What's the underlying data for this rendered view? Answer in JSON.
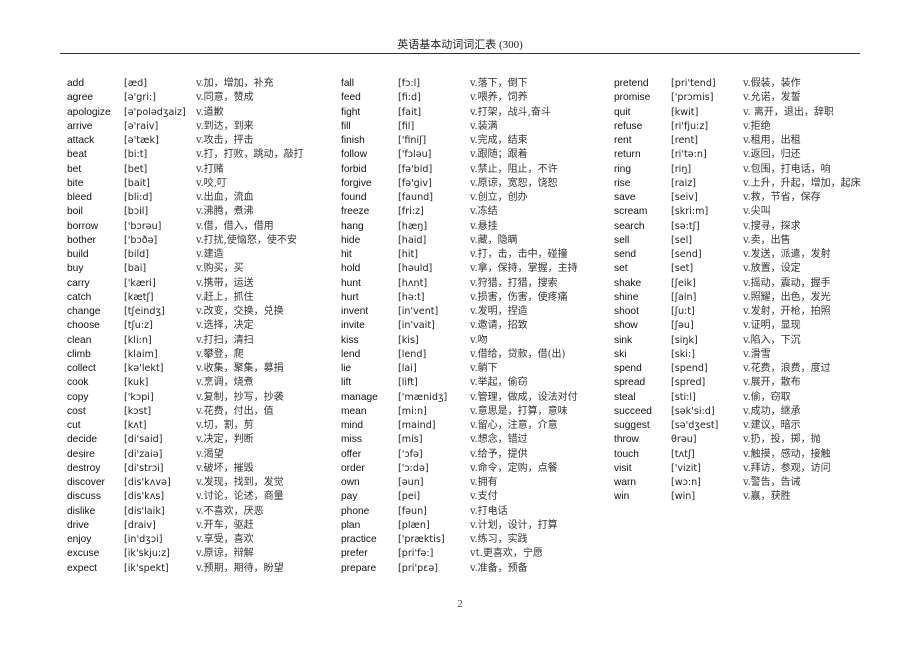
{
  "header": {
    "title": "英语基本动词词汇表 (300)"
  },
  "page_number": "2",
  "columns": [
    [
      {
        "word": "add",
        "ipa": "[æd]",
        "meaning": "v.加，增加，补充"
      },
      {
        "word": "agree",
        "ipa": "[ə'gri:]",
        "meaning": "v.同意，赞成"
      },
      {
        "word": "apologize",
        "ipa": "[ə'polədʒaiz]",
        "meaning": "v.道歉"
      },
      {
        "word": "arrive",
        "ipa": "[ə'raiv]",
        "meaning": "v.到达，到来"
      },
      {
        "word": "attack",
        "ipa": "[ə'tæk]",
        "meaning": "v.攻击，抨击"
      },
      {
        "word": "beat",
        "ipa": "[bi:t]",
        "meaning": "v.打，打败，跳动，敲打"
      },
      {
        "word": "bet",
        "ipa": "[bet]",
        "meaning": "v.打赌"
      },
      {
        "word": "bite",
        "ipa": "[bait]",
        "meaning": "v.咬,叮"
      },
      {
        "word": "bleed",
        "ipa": "[bli:d]",
        "meaning": "v.出血，流血"
      },
      {
        "word": "boil",
        "ipa": "[bɔil]",
        "meaning": "v.沸腾，煮沸"
      },
      {
        "word": "borrow",
        "ipa": "['bɔrəu]",
        "meaning": "v.借，借入，借用"
      },
      {
        "word": "bother",
        "ipa": "['bɔðə]",
        "meaning": "v.打扰,使恼怒，使不安"
      },
      {
        "word": "build",
        "ipa": "[bild]",
        "meaning": "v.建造"
      },
      {
        "word": "buy",
        "ipa": "[bai]",
        "meaning": "v.购买，买"
      },
      {
        "word": "carry",
        "ipa": "['kæri]",
        "meaning": "v.携带，运送"
      },
      {
        "word": "catch",
        "ipa": "[kætʃ]",
        "meaning": "v.赶上，抓住"
      },
      {
        "word": "change",
        "ipa": "[tʃeindʒ]",
        "meaning": "v.改变，交换，兑换"
      },
      {
        "word": "choose",
        "ipa": "[tʃu:z]",
        "meaning": "v.选择，决定"
      },
      {
        "word": "clean",
        "ipa": "[kli:n]",
        "meaning": "v.打扫，清扫"
      },
      {
        "word": "climb",
        "ipa": "[klaim]",
        "meaning": "v.攀登，爬"
      },
      {
        "word": "collect",
        "ipa": "[kə'lekt]",
        "meaning": "v.收集，聚集，募捐"
      },
      {
        "word": "cook",
        "ipa": "[kuk]",
        "meaning": "v.烹调，烧煮"
      },
      {
        "word": "copy",
        "ipa": "['kɔpi]",
        "meaning": "v.复制，抄写，抄袭"
      },
      {
        "word": "cost",
        "ipa": "[kɔst]",
        "meaning": "v.花费，付出，值"
      },
      {
        "word": "cut",
        "ipa": "[kʌt]",
        "meaning": "v.切，割，剪"
      },
      {
        "word": "decide",
        "ipa": "[di'said]",
        "meaning": "v.决定，判断"
      },
      {
        "word": "desire",
        "ipa": "[di'zaiə]",
        "meaning": "v.渴望"
      },
      {
        "word": "destroy",
        "ipa": "[di'strɔi]",
        "meaning": "v.破坏，摧毁"
      },
      {
        "word": "discover",
        "ipa": "[dis'kʌvə]",
        "meaning": "v.发现，找到，发觉"
      },
      {
        "word": "discuss",
        "ipa": "[dis'kʌs]",
        "meaning": "v.讨论，论述，商量"
      },
      {
        "word": "dislike",
        "ipa": "[dis'laik]",
        "meaning": "v.不喜欢，厌恶"
      },
      {
        "word": "drive",
        "ipa": "[draiv]",
        "meaning": "v.开车，驱赶"
      },
      {
        "word": "enjoy",
        "ipa": "[in'dʒɔi]",
        "meaning": "v.享受，喜欢"
      },
      {
        "word": "excuse",
        "ipa": "[ik'skju:z]",
        "meaning": "v.原谅，辩解"
      },
      {
        "word": "expect",
        "ipa": "[ik'spekt]",
        "meaning": "v.预期，期待，盼望"
      }
    ],
    [
      {
        "word": "fall",
        "ipa": "[fɔ:l]",
        "meaning": "v.落下，倒下"
      },
      {
        "word": "feed",
        "ipa": "[fi:d]",
        "meaning": "v.喂养，饲养"
      },
      {
        "word": "fight",
        "ipa": "[fait]",
        "meaning": "v.打架，战斗,奋斗"
      },
      {
        "word": "fill",
        "ipa": "[fil]",
        "meaning": "v.装满"
      },
      {
        "word": "finish",
        "ipa": "['finiʃ]",
        "meaning": "v.完成，结束"
      },
      {
        "word": "follow",
        "ipa": "['fɔləu]",
        "meaning": "v.跟随；跟着"
      },
      {
        "word": "forbid",
        "ipa": "[fə'bid]",
        "meaning": "v.禁止，阻止，不许"
      },
      {
        "word": "forgive",
        "ipa": "[fə'giv]",
        "meaning": "v.原谅，宽恕，饶恕"
      },
      {
        "word": "found",
        "ipa": "[faund]",
        "meaning": "v.创立，创办"
      },
      {
        "word": "freeze",
        "ipa": "[fri:z]",
        "meaning": "v.冻结"
      },
      {
        "word": "hang",
        "ipa": "[hæŋ]",
        "meaning": "v.悬挂"
      },
      {
        "word": "hide",
        "ipa": "[haid]",
        "meaning": "v.藏，隐瞒"
      },
      {
        "word": "hit",
        "ipa": "[hit]",
        "meaning": "v.打，击，击中，碰撞"
      },
      {
        "word": "hold",
        "ipa": "[həuld]",
        "meaning": "v.拿，保持，掌握，主持"
      },
      {
        "word": "hunt",
        "ipa": "[hʌnt]",
        "meaning": "v.狩猎，打猎，搜索"
      },
      {
        "word": "hurt",
        "ipa": "[hə:t]",
        "meaning": "v.损害，伤害，使疼痛"
      },
      {
        "word": "invent",
        "ipa": "[in'vent]",
        "meaning": "v.发明，捏造"
      },
      {
        "word": "invite",
        "ipa": "[in'vait]",
        "meaning": "v.邀请，招致"
      },
      {
        "word": "kiss",
        "ipa": "[kis]",
        "meaning": "v.吻"
      },
      {
        "word": "lend",
        "ipa": "[lend]",
        "meaning": "v.借给，贷款，借(出)"
      },
      {
        "word": "lie",
        "ipa": "[lai]",
        "meaning": "v.躺下"
      },
      {
        "word": "lift",
        "ipa": "[lift]",
        "meaning": "v.举起，偷窃"
      },
      {
        "word": "manage",
        "ipa": "['mænidʒ]",
        "meaning": "v.管理，做成，设法对付"
      },
      {
        "word": "mean",
        "ipa": "[mi:n]",
        "meaning": "v.意思是，打算，意味"
      },
      {
        "word": "mind",
        "ipa": "[maind]",
        "meaning": "v.留心，注意，介意"
      },
      {
        "word": "miss",
        "ipa": "[mis]",
        "meaning": "v.想念，错过"
      },
      {
        "word": "offer",
        "ipa": "['ɔfə]",
        "meaning": "v.给予，提供"
      },
      {
        "word": "order",
        "ipa": "['ɔ:də]",
        "meaning": "v.命令，定购，点餐"
      },
      {
        "word": "own",
        "ipa": "[əun]",
        "meaning": "v.拥有"
      },
      {
        "word": "pay",
        "ipa": "[pei]",
        "meaning": "v.支付"
      },
      {
        "word": "phone",
        "ipa": "[fəun]",
        "meaning": "v.打电话"
      },
      {
        "word": "plan",
        "ipa": "[plæn]",
        "meaning": "v.计划，设计，打算"
      },
      {
        "word": "practice",
        "ipa": "['præktis]",
        "meaning": "v.练习，实践"
      },
      {
        "word": "prefer",
        "ipa": "[pri'fə:]",
        "meaning": "vt.更喜欢，宁愿"
      },
      {
        "word": "prepare",
        "ipa": "[pri'pεə]",
        "meaning": "v.准备，预备"
      }
    ],
    [
      {
        "word": "pretend",
        "ipa": "[pri'tend]",
        "meaning": "v.假装，装作"
      },
      {
        "word": "promise",
        "ipa": "['prɔmis]",
        "meaning": "v.允诺，发誓"
      },
      {
        "word": "quit",
        "ipa": "[kwit]",
        "meaning": "v. 离开，退出，辞职"
      },
      {
        "word": "refuse",
        "ipa": "[ri'fju:z]",
        "meaning": "v.拒绝"
      },
      {
        "word": "rent",
        "ipa": "[rent]",
        "meaning": "v.租用，出租"
      },
      {
        "word": "return",
        "ipa": "[ri'tə:n]",
        "meaning": "v.返回，归还"
      },
      {
        "word": "ring",
        "ipa": "[riŋ]",
        "meaning": "v.包围，打电话，响"
      },
      {
        "word": "rise",
        "ipa": "[raiz]",
        "meaning": "v.上升，升起，增加，起床"
      },
      {
        "word": "save",
        "ipa": "[seiv]",
        "meaning": "v.救，节省，保存"
      },
      {
        "word": "scream",
        "ipa": "[skri:m]",
        "meaning": "v.尖叫"
      },
      {
        "word": "search",
        "ipa": "[sə:tʃ]",
        "meaning": "v.搜寻，探求"
      },
      {
        "word": "sell",
        "ipa": "[sel]",
        "meaning": "v.卖，出售"
      },
      {
        "word": "send",
        "ipa": "[send]",
        "meaning": "v.发送，派遣，发射"
      },
      {
        "word": "set",
        "ipa": "[set]",
        "meaning": "v.放置，设定"
      },
      {
        "word": "shake",
        "ipa": "[ʃeik]",
        "meaning": "v.摇动，震动，握手"
      },
      {
        "word": "shine",
        "ipa": "[ʃain]",
        "meaning": "v.照耀，出色，发光"
      },
      {
        "word": "shoot",
        "ipa": "[ʃu:t]",
        "meaning": "v.发射，开枪，拍照"
      },
      {
        "word": "show",
        "ipa": "[ʃəu]",
        "meaning": "v.证明，显现"
      },
      {
        "word": "sink",
        "ipa": "[siŋk]",
        "meaning": "v.陷入，下沉"
      },
      {
        "word": "ski",
        "ipa": "[ski:]",
        "meaning": "v.滑雪"
      },
      {
        "word": "spend",
        "ipa": "[spend]",
        "meaning": "v.花费，浪费，度过"
      },
      {
        "word": "spread",
        "ipa": "[spred]",
        "meaning": "v.展开，散布"
      },
      {
        "word": "steal",
        "ipa": "[sti:l]",
        "meaning": "v.偷，窃取"
      },
      {
        "word": "succeed",
        "ipa": "[sək'si:d]",
        "meaning": "v.成功，继承"
      },
      {
        "word": "suggest",
        "ipa": "[sə'dʒest]",
        "meaning": "v.建议，暗示"
      },
      {
        "word": "throw",
        "ipa": "θrəu]",
        "meaning": "v.扔，投，掷，抛"
      },
      {
        "word": "touch",
        "ipa": "[tʌtʃ]",
        "meaning": "v.触摸，感动，接触"
      },
      {
        "word": "visit",
        "ipa": "['vizit]",
        "meaning": "v.拜访，参观，访问"
      },
      {
        "word": "warn",
        "ipa": "[wɔ:n]",
        "meaning": "v.警告，告诫"
      },
      {
        "word": "win",
        "ipa": "[win]",
        "meaning": "v.赢，获胜"
      }
    ]
  ]
}
